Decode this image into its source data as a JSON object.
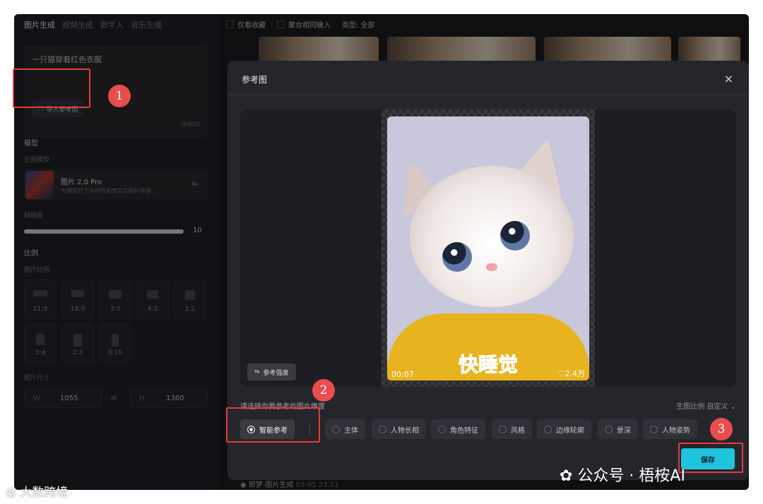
{
  "sidebar": {
    "tabs": [
      "图片生成",
      "视频生成",
      "数字人",
      "音乐生成"
    ],
    "prompt_text": "一只猫穿着红色衣服",
    "import_label": "导入参考图",
    "char_count": "9/800",
    "model_section": "模型",
    "gen_model_label": "生图模型",
    "model_name": "图片 2.0 Pro",
    "model_desc": "大幅提升了多样性和真实的图片质感...",
    "precision_label": "精细度",
    "precision_value": "10",
    "ratio_section": "比例",
    "ratio_label": "图片比例",
    "ratios": [
      "21:9",
      "16:9",
      "3:2",
      "4:3",
      "1:1",
      "3:4",
      "2:3",
      "9:16"
    ],
    "size_label": "图片尺寸",
    "width_key": "W",
    "width_value": "1055",
    "height_key": "H",
    "height_value": "1360"
  },
  "gallery": {
    "opt_favorites": "仅看收藏",
    "opt_aggregate": "聚合相同输入",
    "type_filter": "类型: 全部",
    "footer_item": "即梦-图片生成",
    "footer_time": "03-05 23:11"
  },
  "modal": {
    "title": "参考图",
    "close": "×",
    "video_time": "00:07",
    "video_likes": "♡2.4万",
    "caption": "快睡觉",
    "strength_label": "参考强度",
    "dim_hint": "请选择你要参考的图片维度",
    "ratio_hint": "生图比例 自定义",
    "options": [
      "智能参考",
      "主体",
      "人物长相",
      "角色特征",
      "风格",
      "边缘轮廓",
      "景深",
      "人物姿势"
    ],
    "save_label": "保存"
  },
  "annotations": [
    "1",
    "2",
    "3"
  ],
  "watermarks": {
    "left": "大数跨境",
    "right": "公众号 · 梧桉AI"
  },
  "colors": {
    "accent": "#1fc3dc",
    "annotation": "#e83a3a"
  }
}
